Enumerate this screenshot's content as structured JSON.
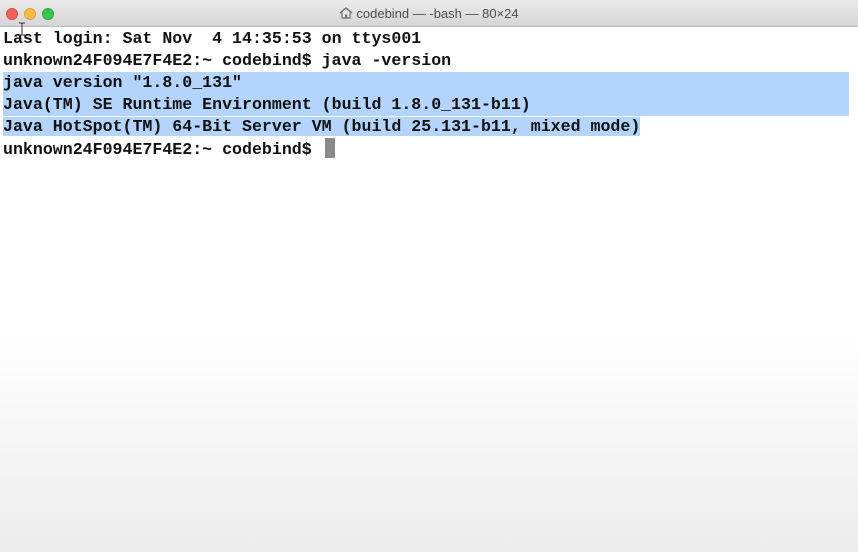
{
  "window": {
    "title": "codebind — -bash — 80×24",
    "colors": {
      "close": "#fc605c",
      "minimize": "#fdbc40",
      "zoom": "#34c84a",
      "selection": "#b3d4fc",
      "cursor": "#8a8a8a",
      "text": "#111111"
    },
    "icons": {
      "title_icon": "home-icon",
      "pointer": "ibeam-cursor-icon"
    }
  },
  "terminal": {
    "lines": [
      "Last login: Sat Nov  4 14:35:53 on ttys001",
      "unknown24F094E7F4E2:~ codebind$ java -version",
      "java version \"1.8.0_131\"",
      "Java(TM) SE Runtime Environment (build 1.8.0_131-b11)",
      "Java HotSpot(TM) 64-Bit Server VM (build 25.131-b11, mixed mode)",
      "unknown24F094E7F4E2:~ codebind$ "
    ]
  }
}
